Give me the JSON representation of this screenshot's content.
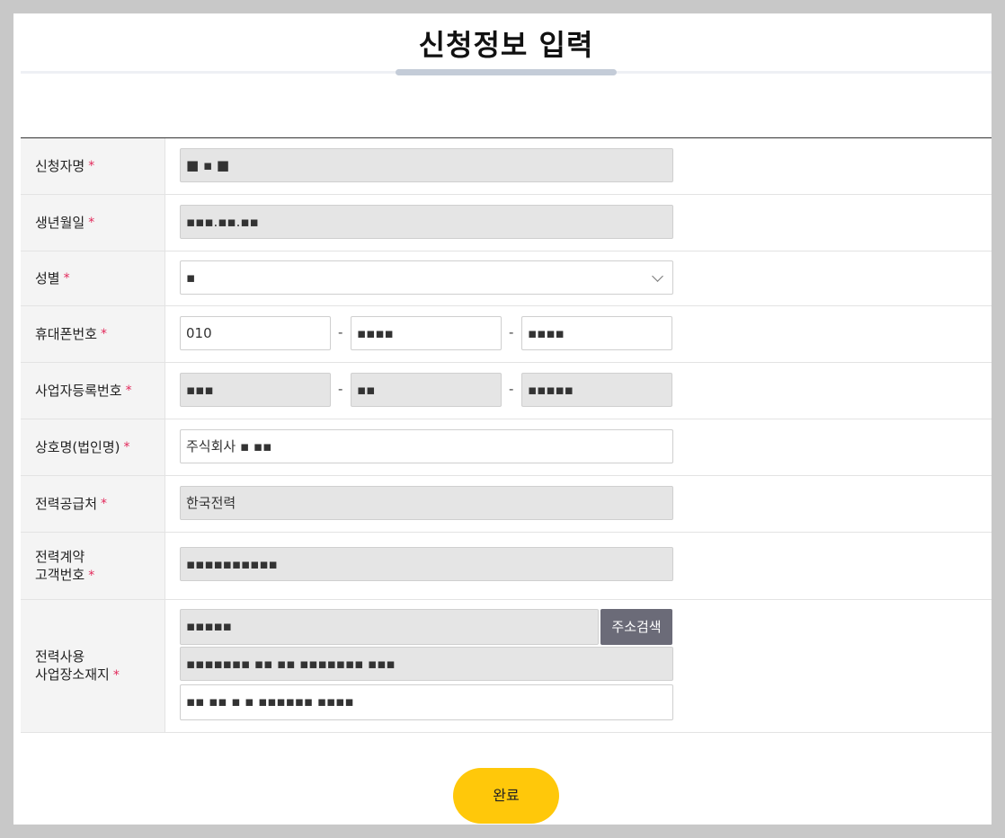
{
  "title": "신청정보 입력",
  "required_mark": "*",
  "fields": {
    "applicant_name": {
      "label": "신청자명",
      "value": "■ ▪ ■"
    },
    "birth_date": {
      "label": "생년월일",
      "value": "▪▪▪.▪▪.▪▪"
    },
    "gender": {
      "label": "성별",
      "value": "▪"
    },
    "mobile": {
      "label": "휴대폰번호",
      "part1": "010",
      "part2": "▪▪▪▪",
      "part3": "▪▪▪▪",
      "separator": "-"
    },
    "business_number": {
      "label": "사업자등록번호",
      "part1": "▪▪▪",
      "part2": "▪▪",
      "part3": "▪▪▪▪▪",
      "separator": "-"
    },
    "company_name": {
      "label": "상호명(법인명)",
      "value": "주식회사 ▪ ▪▪"
    },
    "power_supplier": {
      "label": "전력공급처",
      "value": "한국전력"
    },
    "contract_number": {
      "label_line1": "전력계약",
      "label_line2": "고객번호",
      "value": "▪▪▪▪▪▪▪▪▪▪"
    },
    "site_address": {
      "label_line1": "전력사용",
      "label_line2": "사업장소재지",
      "zipcode": "▪▪▪▪▪",
      "address1": "▪▪▪▪▪▪▪ ▪▪ ▪▪ ▪▪▪▪▪▪▪ ▪▪▪",
      "address2": "▪▪ ▪▪ ▪ ▪ ▪▪▪▪▪▪ ▪▪▪▪",
      "search_button": "주소검색"
    }
  },
  "done_button": "완료",
  "colors": {
    "accent_button": "#ffc80a",
    "required": "#e2285a",
    "readonly_bg": "#e5e5e5",
    "search_button_bg": "#6b6b78"
  }
}
